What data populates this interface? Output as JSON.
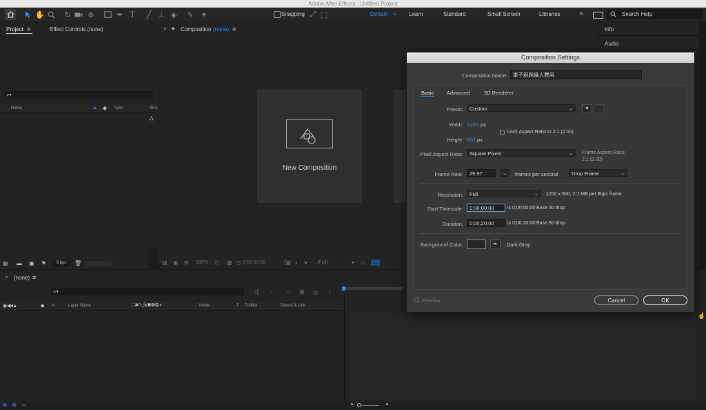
{
  "window": {
    "title": "Adobe After Effects - Untitled Project"
  },
  "toolbar": {
    "snapping_label": "Snapping",
    "workspaces": [
      "Default",
      "Learn",
      "Standard",
      "Small Screen",
      "Libraries"
    ],
    "search_placeholder": "Search Help"
  },
  "project_panel": {
    "tab_project": "Project",
    "tab_effect_controls": "Effect Controls (none)",
    "col_name": "Name",
    "col_type": "Type",
    "col_size": "Size",
    "bpc": "8 bpc"
  },
  "composition_panel": {
    "tab_label": "Composition",
    "tab_value": "(none)",
    "new_composition": "New Composition",
    "zoom": "100%",
    "timecode": "0:00:00:00",
    "resolution": "(Full)"
  },
  "right_panel": {
    "info": "Info",
    "audio": "Audio"
  },
  "timeline": {
    "tab_label": "(none)",
    "col_layer_name": "Layer Name",
    "col_mode": "Mode",
    "col_t": "T",
    "col_trkmat": "TrkMat",
    "col_parent": "Parent & Link"
  },
  "dialog": {
    "title": "Composition Settings",
    "comp_name_label": "Composition Name:",
    "comp_name_value": "車子跑跑識人費用",
    "tabs": [
      "Basic",
      "Advanced",
      "3D Renderer"
    ],
    "preset_label": "Preset:",
    "preset_value": "Custom",
    "width_label": "Width:",
    "width_value": "1200",
    "height_label": "Height:",
    "height_value": "600",
    "px_unit": "px",
    "lock_aspect": "Lock Aspect Ratio to 2:1 (2.00)",
    "par_label": "Pixel Aspect Ratio:",
    "par_value": "Square Pixels",
    "frame_aspect_label": "Frame Aspect Ratio:",
    "frame_aspect_value": "2:1 (2.00)",
    "frame_rate_label": "Frame Rate:",
    "frame_rate_value": "29.97",
    "fps_text": "frames per second",
    "drop_frame_value": "Drop Frame",
    "resolution_label": "Resolution:",
    "resolution_value": "Full",
    "resolution_info": "1200 x 600, 2.7 MB per 8bpc frame",
    "start_tc_label": "Start Timecode:",
    "start_tc_value": "0;00;00;00",
    "start_tc_info": "is 0;00;00;00  Base 30  drop",
    "duration_label": "Duration:",
    "duration_value": "0;00;20;00",
    "duration_info": "is 0;00;20;00  Base 30  drop",
    "bg_color_label": "Background Color:",
    "bg_color_name": "Dark Gray",
    "preview_label": "Preview",
    "cancel_label": "Cancel",
    "ok_label": "OK"
  },
  "colors": {
    "accent": "#2d8ceb",
    "panel": "#232323",
    "dialog": "#3a3a3a"
  }
}
